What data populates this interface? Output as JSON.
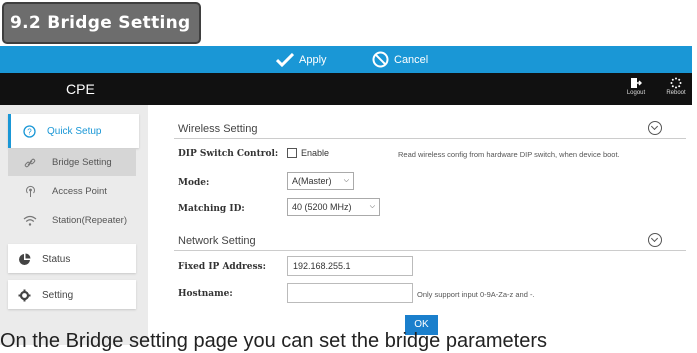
{
  "doc": {
    "section_title": "9.2 Bridge Setting",
    "caption": "On the Bridge setting page you can set the bridge parameters"
  },
  "topbar": {
    "apply_label": "Apply",
    "cancel_label": "Cancel"
  },
  "header": {
    "brand": "CPE",
    "logout_label": "Logout",
    "reboot_label": "Reboot"
  },
  "sidebar": {
    "quick_setup": "Quick Setup",
    "sub_items": [
      "Bridge Setting",
      "Access Point",
      "Station(Repeater)"
    ],
    "status": "Status",
    "setting": "Setting"
  },
  "wireless": {
    "title": "Wireless Setting",
    "dip_label": "DIP Switch Control:",
    "dip_checkbox": "Enable",
    "dip_note": "Read wireless config from hardware DIP switch, when device boot.",
    "mode_label": "Mode:",
    "mode_value": "A(Master)",
    "matching_label": "Matching ID:",
    "matching_value": "40 (5200 MHz)"
  },
  "network": {
    "title": "Network Setting",
    "ip_label": "Fixed IP Address:",
    "ip_value": "192.168.255.1",
    "hostname_label": "Hostname:",
    "hostname_value": "",
    "hostname_note": "Only support input 0-9A-Za-z and -."
  },
  "ok_label": "OK",
  "colors": {
    "topbar": "#1a97d6",
    "header": "#111111",
    "accent": "#1a97d6",
    "ok_button": "#1a7fcc"
  }
}
